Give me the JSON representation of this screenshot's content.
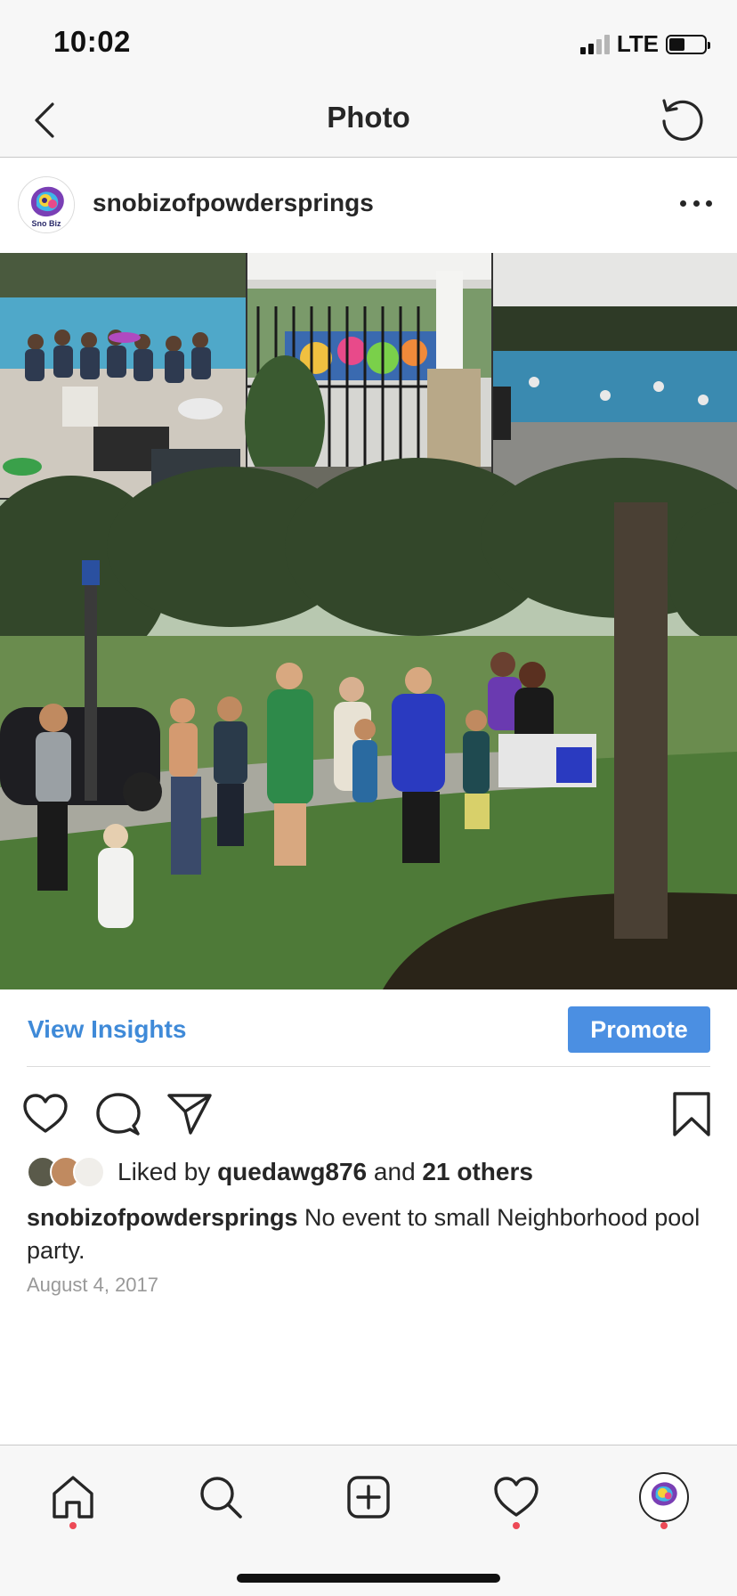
{
  "status_bar": {
    "time": "10:02",
    "network": "LTE",
    "battery_level": 0.45
  },
  "nav": {
    "title": "Photo",
    "back_icon": "chevron-left-icon",
    "refresh_icon": "refresh-icon"
  },
  "post": {
    "username": "snobizofpowdersprings",
    "more_icon": "more-horizontal-icon",
    "photo_description": "collage of pool party and shaved ice line",
    "avatar_logo_text": "Sno Biz"
  },
  "insights": {
    "view_label": "View Insights",
    "promote_label": "Promote"
  },
  "actions": {
    "like_icon": "heart-icon",
    "comment_icon": "comment-icon",
    "share_icon": "send-icon",
    "save_icon": "bookmark-icon"
  },
  "likes": {
    "prefix": "Liked by ",
    "first_liker": "quedawg876",
    "middle": " and ",
    "others": "21 others"
  },
  "caption": {
    "username": "snobizofpowdersprings",
    "text": " No event to small Neighborhood pool party."
  },
  "date": "August 4, 2017",
  "tab_bar": {
    "items": [
      {
        "name": "home",
        "icon": "home-icon",
        "has_dot": true
      },
      {
        "name": "search",
        "icon": "search-icon",
        "has_dot": false
      },
      {
        "name": "new-post",
        "icon": "plus-square-icon",
        "has_dot": false
      },
      {
        "name": "activity",
        "icon": "heart-icon",
        "has_dot": true
      },
      {
        "name": "profile",
        "icon": "profile-avatar",
        "has_dot": true
      }
    ]
  },
  "colors": {
    "accent_blue": "#3f8ad8",
    "promote_bg": "#4b8fe2",
    "notification_dot": "#ed4956",
    "text_primary": "#262626",
    "text_secondary": "#999999"
  }
}
